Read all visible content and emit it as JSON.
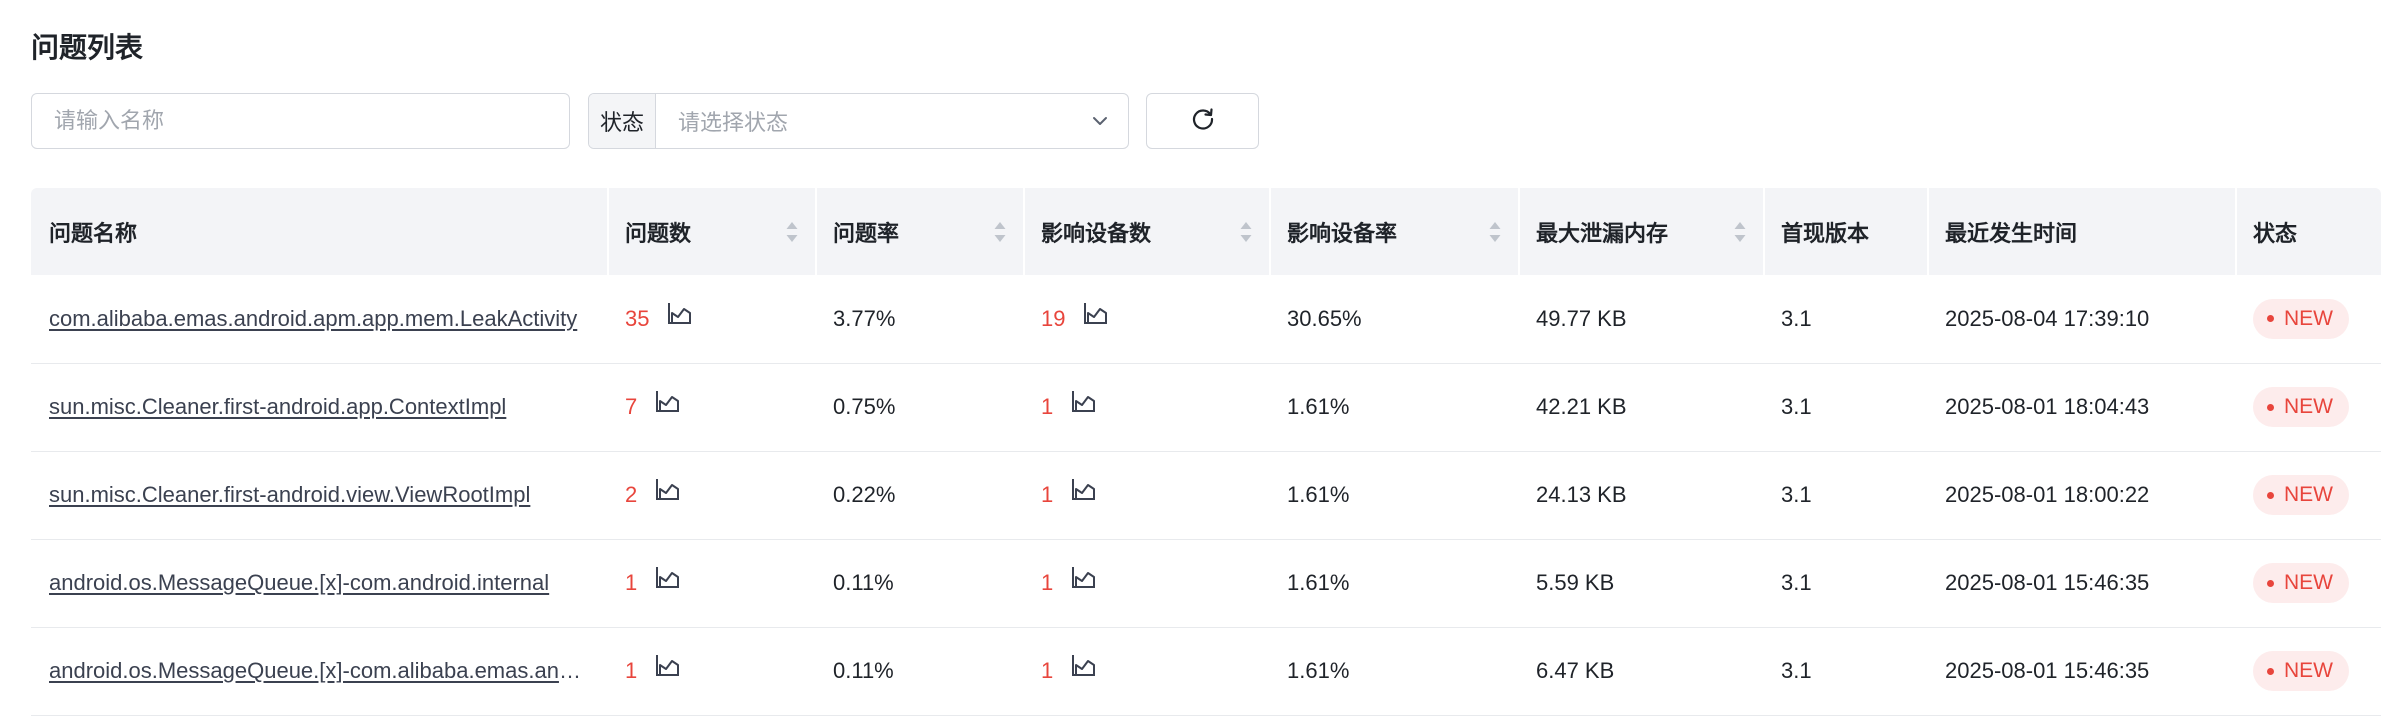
{
  "page": {
    "title": "问题列表"
  },
  "filters": {
    "search_placeholder": "请输入名称",
    "status_prefix": "状态",
    "status_placeholder": "请选择状态"
  },
  "table": {
    "headers": {
      "name": "问题名称",
      "count": "问题数",
      "rate": "问题率",
      "devices": "影响设备数",
      "device_rate": "影响设备率",
      "max_leak": "最大泄漏内存",
      "first_version": "首现版本",
      "last_time": "最近发生时间",
      "status": "状态"
    },
    "rows": [
      {
        "name": "com.alibaba.emas.android.apm.app.mem.LeakActivity",
        "count": "35",
        "rate": "3.77%",
        "devices": "19",
        "device_rate": "30.65%",
        "max_leak": "49.77 KB",
        "first_version": "3.1",
        "last_time": "2025-08-04 17:39:10",
        "status": "NEW"
      },
      {
        "name": "sun.misc.Cleaner.first-android.app.ContextImpl",
        "count": "7",
        "rate": "0.75%",
        "devices": "1",
        "device_rate": "1.61%",
        "max_leak": "42.21 KB",
        "first_version": "3.1",
        "last_time": "2025-08-01 18:04:43",
        "status": "NEW"
      },
      {
        "name": "sun.misc.Cleaner.first-android.view.ViewRootImpl",
        "count": "2",
        "rate": "0.22%",
        "devices": "1",
        "device_rate": "1.61%",
        "max_leak": "24.13 KB",
        "first_version": "3.1",
        "last_time": "2025-08-01 18:00:22",
        "status": "NEW"
      },
      {
        "name": "android.os.MessageQueue.[x]-com.android.internal",
        "count": "1",
        "rate": "0.11%",
        "devices": "1",
        "device_rate": "1.61%",
        "max_leak": "5.59 KB",
        "first_version": "3.1",
        "last_time": "2025-08-01 15:46:35",
        "status": "NEW"
      },
      {
        "name": "android.os.MessageQueue.[x]-com.alibaba.emas.android",
        "count": "1",
        "rate": "0.11%",
        "devices": "1",
        "device_rate": "1.61%",
        "max_leak": "6.47 KB",
        "first_version": "3.1",
        "last_time": "2025-08-01 15:46:35",
        "status": "NEW"
      }
    ]
  },
  "colors": {
    "accent_red": "#e8453c",
    "header_bg": "#f3f4f7",
    "badge_bg": "#fdecec"
  },
  "icons": [
    "chevron-down-icon",
    "refresh-icon",
    "sort-icon",
    "trend-chart-icon"
  ]
}
